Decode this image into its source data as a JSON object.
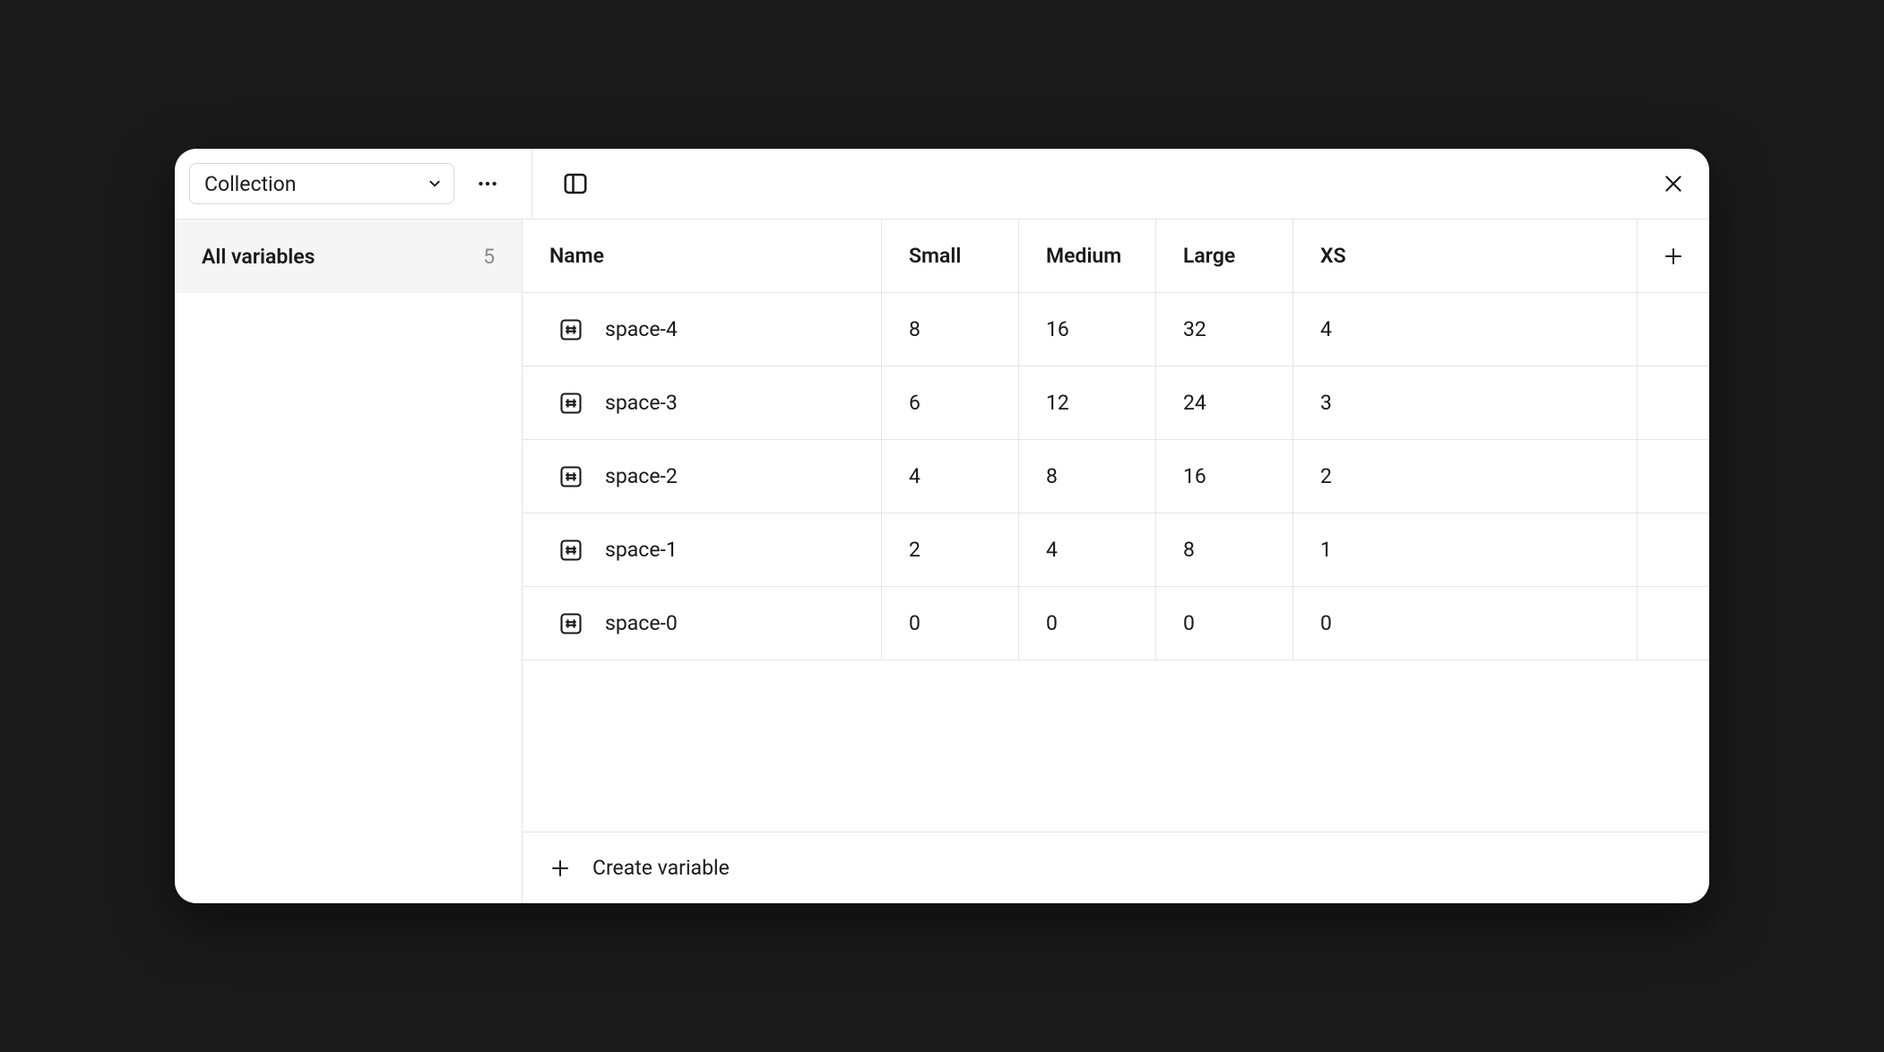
{
  "topbar": {
    "collection_label": "Collection"
  },
  "sidebar": {
    "group_label": "All variables",
    "count": "5"
  },
  "table": {
    "headers": {
      "name": "Name",
      "mode0": "Small",
      "mode1": "Medium",
      "mode2": "Large",
      "mode3": "XS"
    },
    "rows": [
      {
        "name": "space-4",
        "small": "8",
        "medium": "16",
        "large": "32",
        "xs": "4"
      },
      {
        "name": "space-3",
        "small": "6",
        "medium": "12",
        "large": "24",
        "xs": "3"
      },
      {
        "name": "space-2",
        "small": "4",
        "medium": "8",
        "large": "16",
        "xs": "2"
      },
      {
        "name": "space-1",
        "small": "2",
        "medium": "4",
        "large": "8",
        "xs": "1"
      },
      {
        "name": "space-0",
        "small": "0",
        "medium": "0",
        "large": "0",
        "xs": "0"
      }
    ]
  },
  "footer": {
    "create_label": "Create variable"
  }
}
